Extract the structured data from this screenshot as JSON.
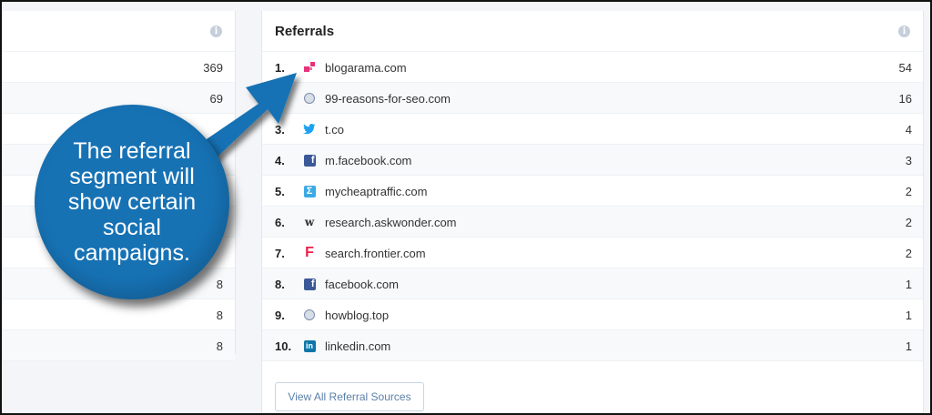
{
  "left_panel": {
    "values": [
      "369",
      "69",
      "",
      "",
      "",
      "",
      "",
      "8",
      "8",
      "8"
    ]
  },
  "referrals": {
    "title": "Referrals",
    "rows": [
      {
        "rank": "1.",
        "icon": "blogarama-icon",
        "domain": "blogarama.com",
        "count": "54"
      },
      {
        "rank": "",
        "icon": "globe-icon",
        "domain": "99-reasons-for-seo.com",
        "count": "16"
      },
      {
        "rank": "3.",
        "icon": "twitter-icon",
        "domain": "t.co",
        "count": "4"
      },
      {
        "rank": "4.",
        "icon": "facebook-icon",
        "domain": "m.facebook.com",
        "count": "3"
      },
      {
        "rank": "5.",
        "icon": "sigma-icon",
        "domain": "mycheaptraffic.com",
        "count": "2"
      },
      {
        "rank": "6.",
        "icon": "wonder-icon",
        "domain": "research.askwonder.com",
        "count": "2"
      },
      {
        "rank": "7.",
        "icon": "frontier-icon",
        "domain": "search.frontier.com",
        "count": "2"
      },
      {
        "rank": "8.",
        "icon": "facebook-icon",
        "domain": "facebook.com",
        "count": "1"
      },
      {
        "rank": "9.",
        "icon": "globe-icon",
        "domain": "howblog.top",
        "count": "1"
      },
      {
        "rank": "10.",
        "icon": "linkedin-icon",
        "domain": "linkedin.com",
        "count": "1"
      }
    ],
    "view_all_label": "View All Referral Sources"
  },
  "callout": {
    "text": "The referral segment will show certain social campaigns."
  },
  "colors": {
    "callout_blue": "#1772b4",
    "button_text": "#5b80a8"
  }
}
